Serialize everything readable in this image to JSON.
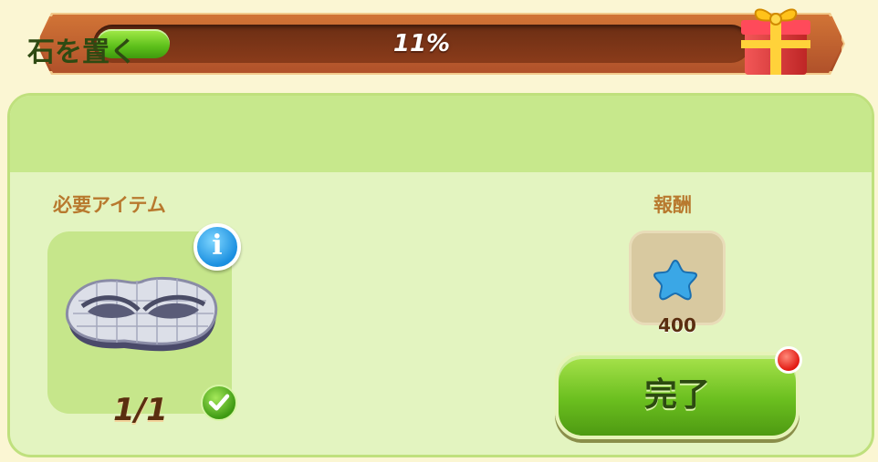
{
  "progress": {
    "percent_label": "11%",
    "value": 0.11,
    "fill_color": "#5cbf1a"
  },
  "gift_icon": "gift-box-icon",
  "task": {
    "title": "石を置く",
    "required_label": "必要アイテム",
    "reward_label": "報酬",
    "item_icon": "stone-mosaic-icon",
    "item_count": "1/1",
    "reward_icon": "blue-star-icon",
    "reward_amount": "400",
    "complete_label": "完了"
  },
  "colors": {
    "banner": "#b8562a",
    "panel": "#e3f4c0",
    "header": "#c7e88c",
    "label_orange": "#b8792e",
    "button_green": "#6bbf1f",
    "notification_red": "#e21a12"
  }
}
